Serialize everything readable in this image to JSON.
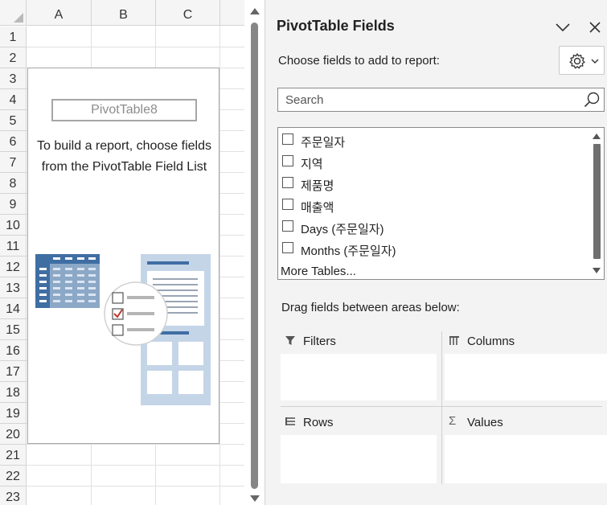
{
  "sheet": {
    "columns": [
      "A",
      "B",
      "C"
    ],
    "rows": [
      "1",
      "2",
      "3",
      "4",
      "5",
      "6",
      "7",
      "8",
      "9",
      "10",
      "11",
      "12",
      "13",
      "14",
      "15",
      "16",
      "17",
      "18",
      "19",
      "20",
      "21",
      "22",
      "23"
    ],
    "pivot": {
      "name": "PivotTable8",
      "hint": "To build a report, choose fields from the PivotTable Field List"
    }
  },
  "pane": {
    "title": "PivotTable Fields",
    "choose_label": "Choose fields to add to report:",
    "search_placeholder": "Search",
    "fields": [
      {
        "label": "주문일자",
        "checked": false
      },
      {
        "label": "지역",
        "checked": false
      },
      {
        "label": "제품명",
        "checked": false
      },
      {
        "label": "매출액",
        "checked": false
      },
      {
        "label": "Days (주문일자)",
        "checked": false
      },
      {
        "label": "Months (주문일자)",
        "checked": false
      }
    ],
    "more_tables": "More Tables...",
    "drag_label": "Drag fields between areas below:",
    "areas": {
      "filters": "Filters",
      "columns": "Columns",
      "rows": "Rows",
      "values": "Values"
    }
  },
  "colors": {
    "accent_blue": "#3f6ea3",
    "light_blue": "#c5d5e8",
    "check_red": "#c0392b"
  }
}
